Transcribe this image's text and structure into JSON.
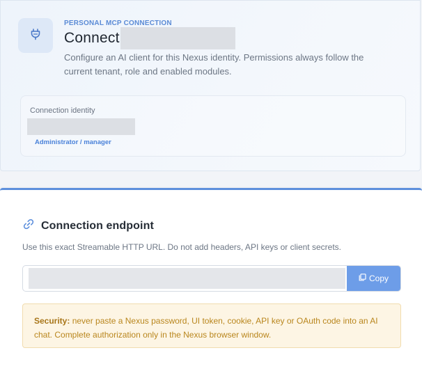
{
  "hero": {
    "eyebrow": "PERSONAL MCP CONNECTION",
    "title": "Connect",
    "description": "Configure an AI client for this Nexus identity. Permissions always follow the current tenant, role and enabled modules.",
    "icon": "plug-icon"
  },
  "identity": {
    "label": "Connection identity",
    "role": "Administrator / manager"
  },
  "endpoint": {
    "icon": "link-icon",
    "title": "Connection endpoint",
    "description": "Use this exact Streamable HTTP URL. Do not add headers, API keys or client secrets.",
    "url_value": "",
    "copy_label": "Copy",
    "copy_icon": "copy-icon"
  },
  "security": {
    "label": "Security:",
    "text": " never paste a Nexus password, UI token, cookie, API key or OAuth code into an AI chat. Complete authorization only in the Nexus browser window."
  },
  "colors": {
    "accent": "#5d8fdc",
    "eyebrow": "#5b8bd6",
    "copy_button": "#6d9de8",
    "warning_bg": "#fdf5e4",
    "warning_text": "#b9861d"
  }
}
